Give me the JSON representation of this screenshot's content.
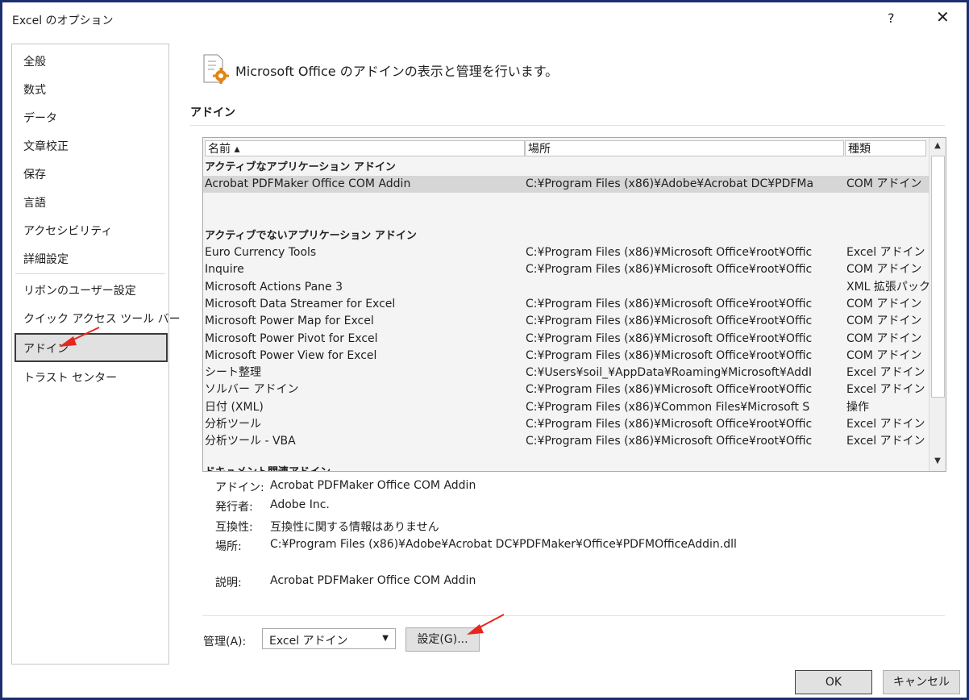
{
  "window": {
    "title": "Excel のオプション",
    "help": "?",
    "close": "✕"
  },
  "nav": {
    "items": [
      {
        "label": "全般"
      },
      {
        "label": "数式"
      },
      {
        "label": "データ"
      },
      {
        "label": "文章校正"
      },
      {
        "label": "保存"
      },
      {
        "label": "言語"
      },
      {
        "label": "アクセシビリティ"
      },
      {
        "label": "詳細設定"
      },
      {
        "label": "リボンのユーザー設定"
      },
      {
        "label": "クイック アクセス ツール バー"
      },
      {
        "label": "アドイン",
        "selected": true
      },
      {
        "label": "トラスト センター"
      }
    ]
  },
  "header": {
    "text": "Microsoft Office のアドインの表示と管理を行います。",
    "icon": "addin-gear-icon"
  },
  "section": {
    "title": "アドイン"
  },
  "list": {
    "columns": {
      "name": "名前 ▴",
      "location": "場所",
      "type": "種類"
    },
    "groups": {
      "active": "アクティブなアプリケーション アドイン",
      "inactive": "アクティブでないアプリケーション アドイン",
      "cutoff": "ドキュメント関連アドイン"
    },
    "active_rows": [
      {
        "name": "Acrobat PDFMaker Office COM Addin",
        "location": "C:¥Program Files (x86)¥Adobe¥Acrobat DC¥PDFMa",
        "type": "COM アドイン",
        "selected": true
      }
    ],
    "inactive_rows": [
      {
        "name": "Euro Currency Tools",
        "location": "C:¥Program Files (x86)¥Microsoft Office¥root¥Offic",
        "type": "Excel アドイン"
      },
      {
        "name": "Inquire",
        "location": "C:¥Program Files (x86)¥Microsoft Office¥root¥Offic",
        "type": "COM アドイン"
      },
      {
        "name": "Microsoft Actions Pane 3",
        "location": "",
        "type": "XML 拡張パック"
      },
      {
        "name": "Microsoft Data Streamer for Excel",
        "location": "C:¥Program Files (x86)¥Microsoft Office¥root¥Offic",
        "type": "COM アドイン"
      },
      {
        "name": "Microsoft Power Map for Excel",
        "location": "C:¥Program Files (x86)¥Microsoft Office¥root¥Offic",
        "type": "COM アドイン"
      },
      {
        "name": "Microsoft Power Pivot for Excel",
        "location": "C:¥Program Files (x86)¥Microsoft Office¥root¥Offic",
        "type": "COM アドイン"
      },
      {
        "name": "Microsoft Power View for Excel",
        "location": "C:¥Program Files (x86)¥Microsoft Office¥root¥Offic",
        "type": "COM アドイン"
      },
      {
        "name": "シート整理",
        "location": "C:¥Users¥soil_¥AppData¥Roaming¥Microsoft¥AddI",
        "type": "Excel アドイン"
      },
      {
        "name": "ソルバー アドイン",
        "location": "C:¥Program Files (x86)¥Microsoft Office¥root¥Offic",
        "type": "Excel アドイン"
      },
      {
        "name": "日付 (XML)",
        "location": "C:¥Program Files (x86)¥Common Files¥Microsoft S",
        "type": "操作"
      },
      {
        "name": "分析ツール",
        "location": "C:¥Program Files (x86)¥Microsoft Office¥root¥Offic",
        "type": "Excel アドイン"
      },
      {
        "name": "分析ツール - VBA",
        "location": "C:¥Program Files (x86)¥Microsoft Office¥root¥Offic",
        "type": "Excel アドイン"
      }
    ],
    "scroll_up": "▲",
    "scroll_down": "▼"
  },
  "details": {
    "addin_label": "アドイン:",
    "addin_value": "Acrobat PDFMaker Office COM Addin",
    "publisher_label": "発行者:",
    "publisher_value": "Adobe Inc.",
    "compat_label": "互換性:",
    "compat_value": "互換性に関する情報はありません",
    "location_label": "場所:",
    "location_value": "C:¥Program Files (x86)¥Adobe¥Acrobat DC¥PDFMaker¥Office¥PDFMOfficeAddin.dll",
    "desc_label": "説明:",
    "desc_value": "Acrobat PDFMaker Office COM Addin"
  },
  "manage": {
    "label": "管理(A):",
    "selected": "Excel アドイン",
    "settings_button": "設定(G)..."
  },
  "footer": {
    "ok": "OK",
    "cancel": "キャンセル"
  },
  "colors": {
    "frame": "#1c2f6e",
    "arrow": "#e8261e",
    "selection": "#d6d6d6"
  }
}
